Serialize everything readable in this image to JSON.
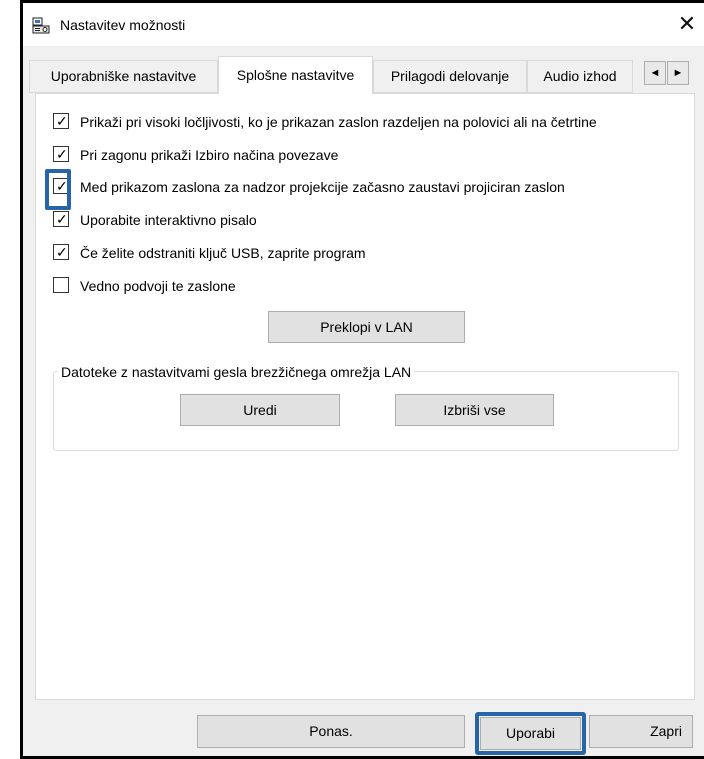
{
  "window": {
    "title": "Nastavitev možnosti",
    "close_glyph": "✕"
  },
  "tabs": [
    {
      "label": "Uporabniške nastavitve",
      "active": false
    },
    {
      "label": "Splošne nastavitve",
      "active": true
    },
    {
      "label": "Prilagodi delovanje",
      "active": false
    },
    {
      "label": "Audio izhod",
      "active": false
    }
  ],
  "tab_scroll": {
    "left": "◄",
    "right": "►"
  },
  "options": [
    {
      "label": "Prikaži pri visoki ločljivosti, ko je prikazan zaslon razdeljen na polovici ali na četrtine",
      "checked": true
    },
    {
      "label": "Pri zagonu prikaži Izbiro načina povezave",
      "checked": true
    },
    {
      "label": "Med prikazom zaslona za nadzor projekcije začasno zaustavi projiciran zaslon",
      "checked": true
    },
    {
      "label": "Uporabite interaktivno pisalo",
      "checked": true
    },
    {
      "label": "Če želite odstraniti ključ USB, zaprite program",
      "checked": true
    },
    {
      "label": "Vedno podvoji te zaslone",
      "checked": false
    }
  ],
  "check_glyph": "✓",
  "switch_lan_button": "Preklopi v LAN",
  "wireless_group": {
    "label": "Datoteke z nastavitvami gesla brezžičnega omrežja LAN",
    "edit_button": "Uredi",
    "delete_all_button": "Izbriši vse"
  },
  "footer": {
    "reset_button": "Ponas.",
    "apply_button": "Uporabi",
    "close_button": "Zapri"
  },
  "colors": {
    "highlight": "#2565a8",
    "dialog_bg": "#f0f0f0",
    "button_bg": "#e1e1e1"
  },
  "icons": {
    "app": "projector-app-icon",
    "close": "close-icon",
    "check": "checkmark-icon"
  }
}
